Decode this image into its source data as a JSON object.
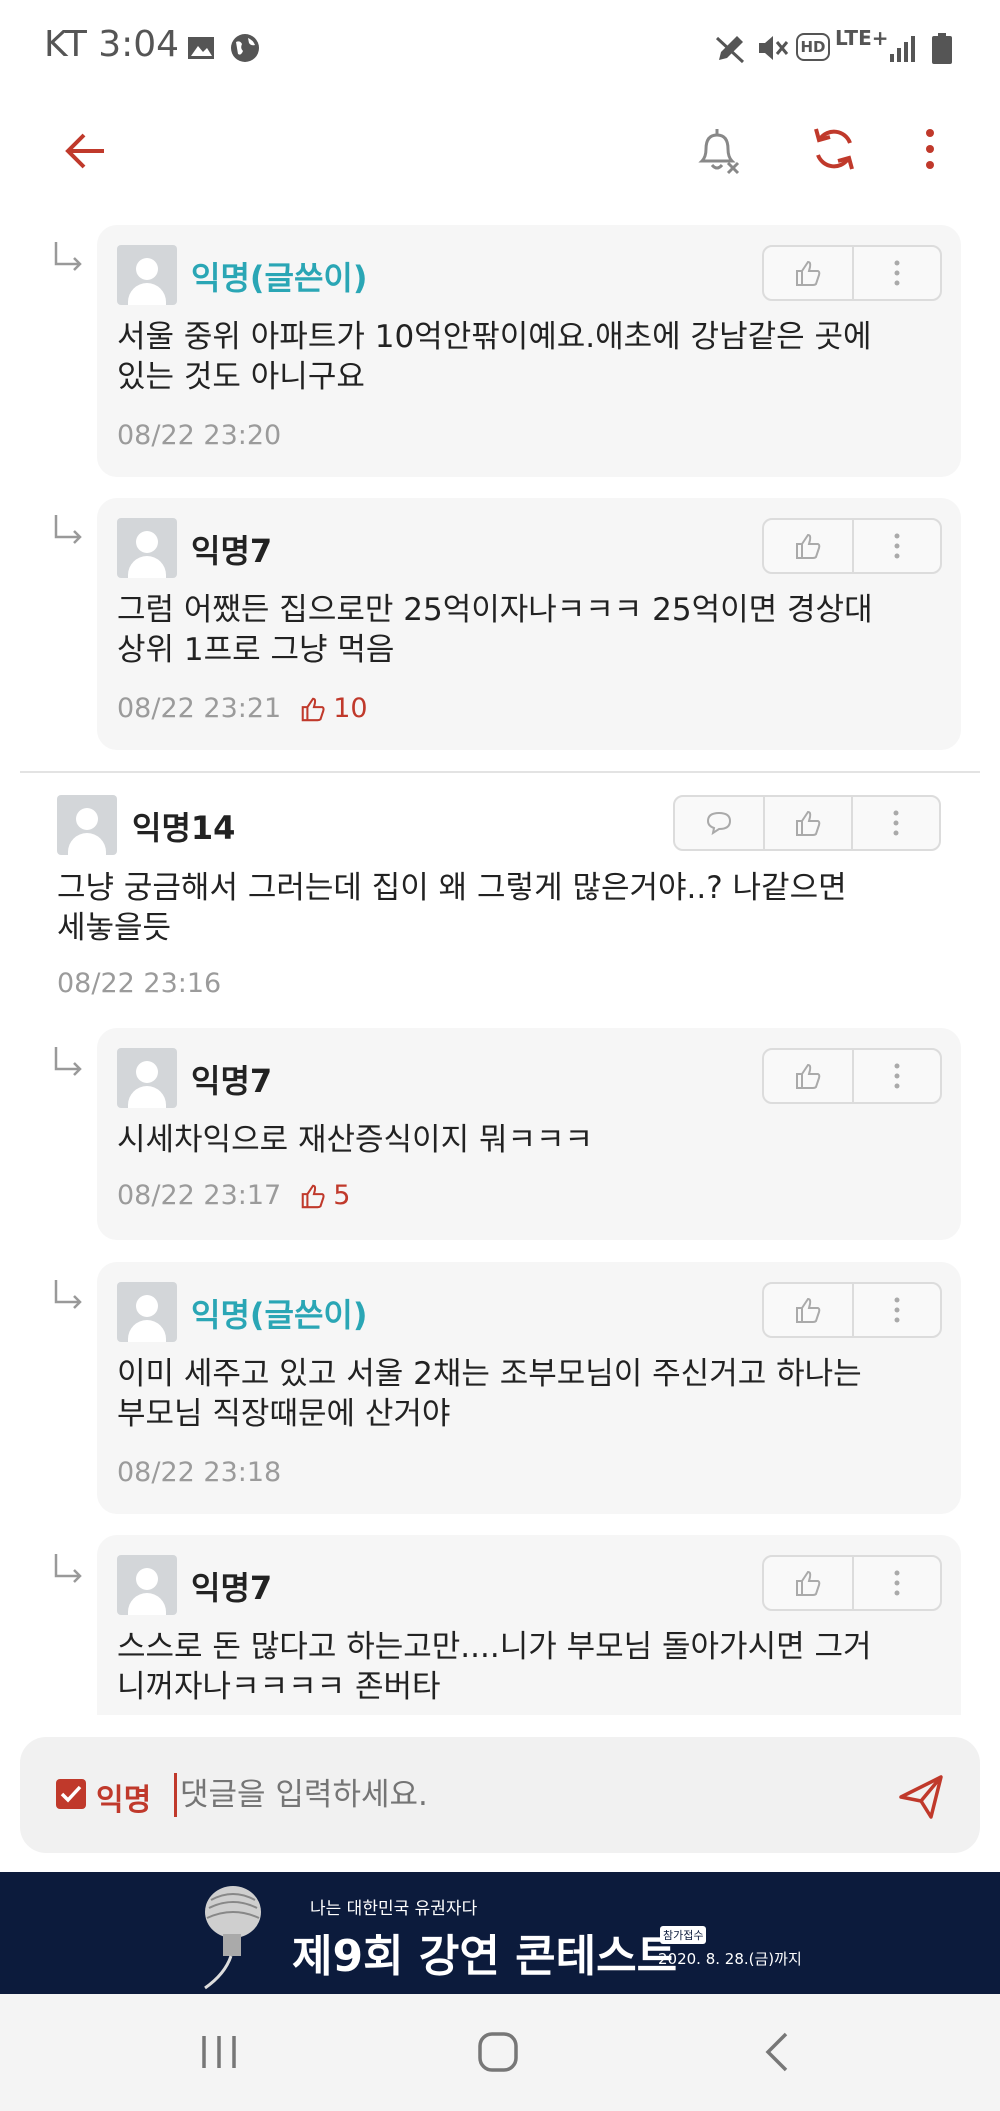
{
  "status_bar": {
    "carrier_time": "KT 3:04",
    "icons": [
      "image-icon",
      "globe-icon",
      "pen-icon",
      "mute-icon",
      "hd-icon",
      "lte-icon",
      "signal-icon",
      "battery-icon"
    ],
    "hd_label": "HD",
    "lte_label": "LTE+"
  },
  "toolbar": {
    "icons": [
      "back-arrow-icon",
      "notification-off-icon",
      "refresh-icon",
      "more-icon"
    ],
    "accent_color": "#c0392b"
  },
  "comments": [
    {
      "type": "reply",
      "author": "익명(글쓴이)",
      "is_op": true,
      "lines": [
        "서울 중위 아파트가 10억안팎이예요.애초에 강남같은 곳에",
        "있는 것도 아니구요"
      ],
      "time": "08/22 23:20",
      "likes": null
    },
    {
      "type": "reply",
      "author": "익명7",
      "is_op": false,
      "lines": [
        "그럼 어쨌든 집으로만 25억이자나ㅋㅋㅋ 25억이면 경상대",
        "상위 1프로 그냥 먹음"
      ],
      "time": "08/22 23:21",
      "likes": "10"
    },
    {
      "type": "comment",
      "author": "익명14",
      "is_op": false,
      "lines": [
        "그냥 궁금해서 그러는데 집이 왜 그렇게 많은거야..? 나같으면",
        "세놓을듯"
      ],
      "time": "08/22 23:16",
      "likes": null
    },
    {
      "type": "reply",
      "author": "익명7",
      "is_op": false,
      "lines": [
        "시세차익으로 재산증식이지 뭐ㅋㅋㅋ"
      ],
      "time": "08/22 23:17",
      "likes": "5"
    },
    {
      "type": "reply",
      "author": "익명(글쓴이)",
      "is_op": true,
      "lines": [
        "이미 세주고 있고 서울 2채는 조부모님이 주신거고 하나는",
        "부모님 직장때문에 산거야"
      ],
      "time": "08/22 23:18",
      "likes": null
    },
    {
      "type": "reply",
      "author": "익명7",
      "is_op": false,
      "lines": [
        "스스로 돈 많다고 하는고만....니가 부모님 돌아가시면 그거",
        "니꺼자나ㅋㅋㅋㅋ 존버타"
      ],
      "time": "",
      "likes": null
    }
  ],
  "input": {
    "anonymous_label": "익명",
    "anonymous_checked": true,
    "placeholder": "댓글을 입력하세요."
  },
  "banner": {
    "tagline": "나는 대한민국 유권자다",
    "title": "제9회 강연 콘테스트",
    "badge": "참가접수",
    "deadline": "2020. 8. 28.(금)까지"
  },
  "nav": {
    "icons": [
      "recent-apps-icon",
      "home-icon",
      "back-icon"
    ]
  }
}
